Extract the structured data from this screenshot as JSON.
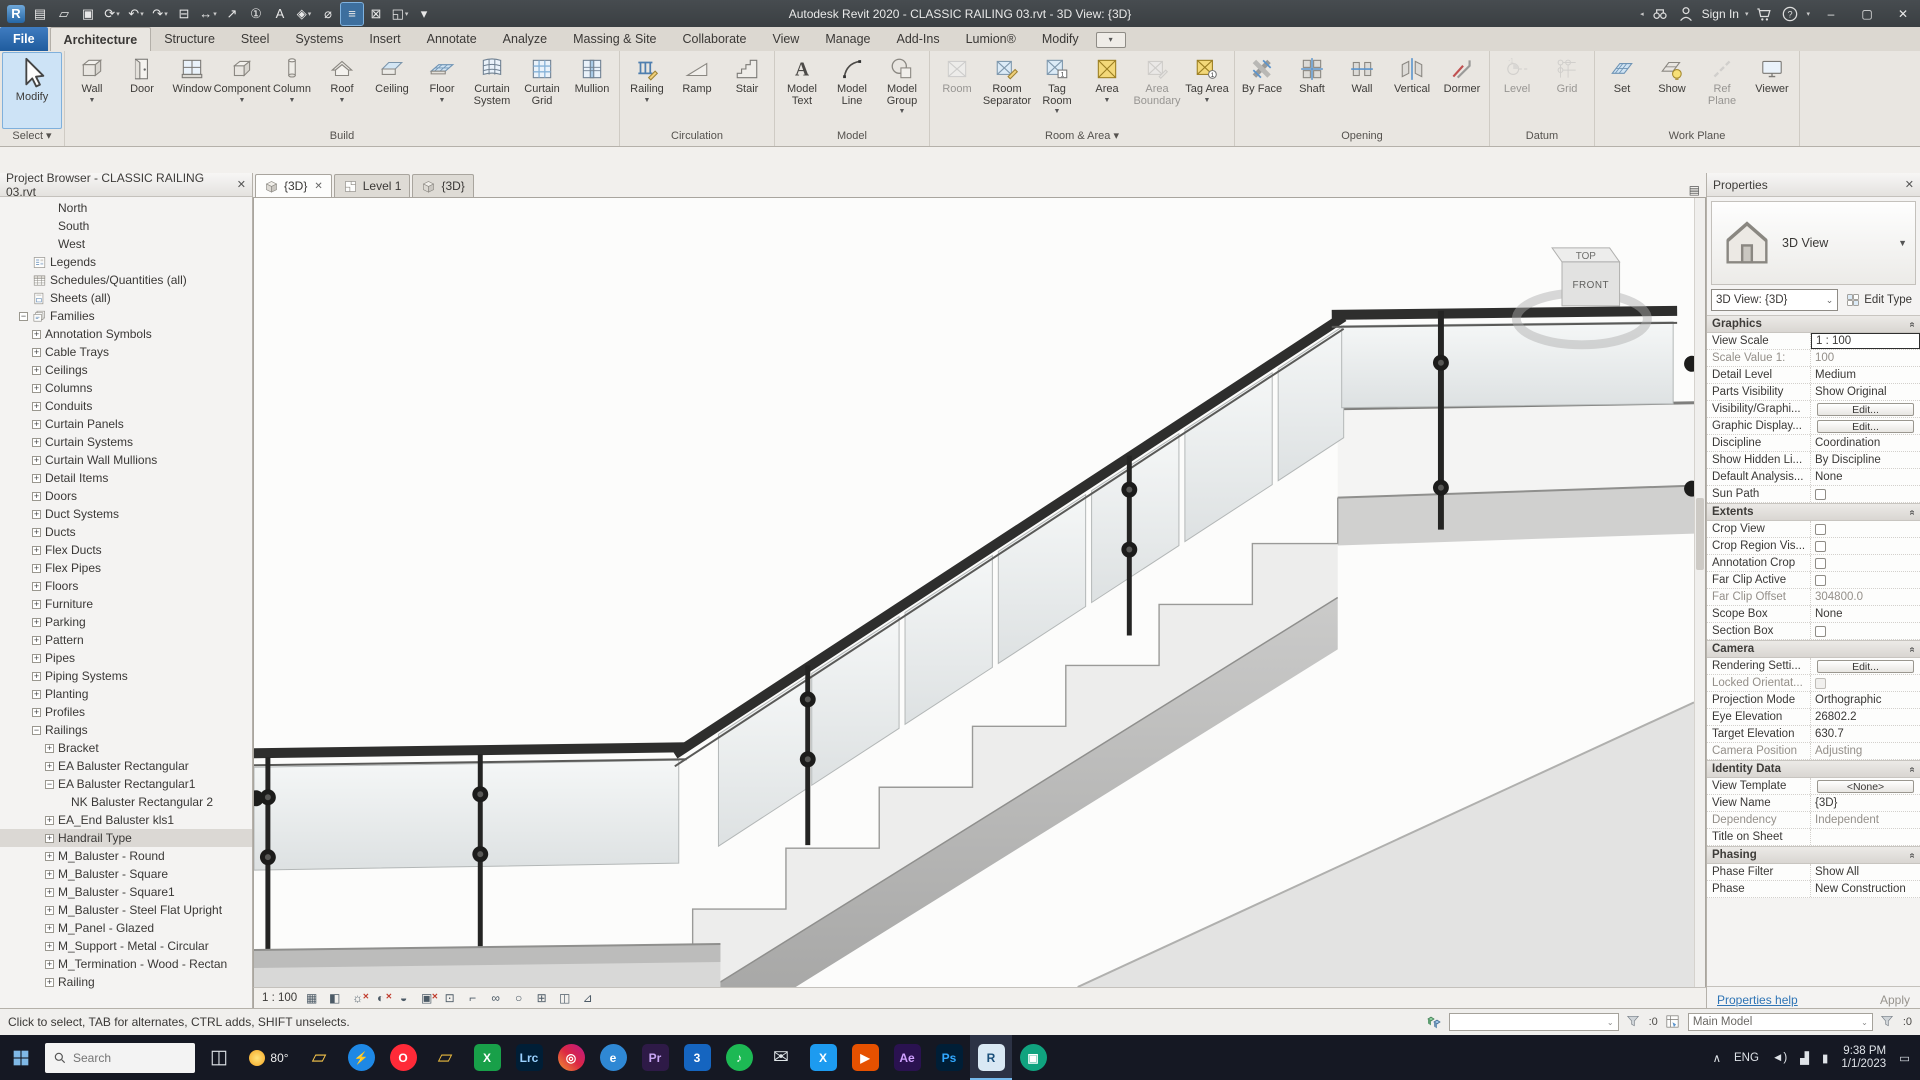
{
  "title_bar": {
    "app_title": "Autodesk Revit 2020 - CLASSIC RAILING 03.rvt - 3D View: {3D}",
    "sign_in_label": "Sign In",
    "qat": [
      {
        "name": "revit-logo-icon",
        "logo": true
      },
      {
        "name": "properties-icon",
        "glyph": "▤"
      },
      {
        "name": "open-icon",
        "glyph": "▱"
      },
      {
        "name": "save-icon",
        "glyph": "▣"
      },
      {
        "name": "sync-with-central-icon",
        "glyph": "⟳",
        "dd": true
      },
      {
        "name": "undo-icon",
        "glyph": "↶",
        "dd": true
      },
      {
        "name": "redo-icon",
        "glyph": "↷",
        "dd": true
      },
      {
        "name": "print-icon",
        "glyph": "⊟"
      },
      {
        "name": "measure-icon",
        "glyph": "↔",
        "dd": true
      },
      {
        "name": "aligned-dimension-icon",
        "glyph": "↗"
      },
      {
        "name": "tag-by-category-icon",
        "glyph": "①"
      },
      {
        "name": "text-icon",
        "glyph": "A"
      },
      {
        "name": "default-3d-view-icon",
        "glyph": "◈",
        "dd": true
      },
      {
        "name": "section-icon",
        "glyph": "⌀"
      },
      {
        "name": "thin-lines-icon",
        "glyph": "≡",
        "hl": true
      },
      {
        "name": "close-inactive-windows-icon",
        "glyph": "⊠"
      },
      {
        "name": "switch-windows-icon",
        "glyph": "◱",
        "dd": true
      },
      {
        "name": "customize-qat-icon",
        "glyph": "▾"
      }
    ]
  },
  "ribbon": {
    "tabs": [
      {
        "label": "File",
        "file": true
      },
      {
        "label": "Architecture",
        "active": true
      },
      {
        "label": "Structure"
      },
      {
        "label": "Steel"
      },
      {
        "label": "Systems"
      },
      {
        "label": "Insert"
      },
      {
        "label": "Annotate"
      },
      {
        "label": "Analyze"
      },
      {
        "label": "Massing & Site"
      },
      {
        "label": "Collaborate"
      },
      {
        "label": "View"
      },
      {
        "label": "Manage"
      },
      {
        "label": "Add-Ins"
      },
      {
        "label": "Lumion®"
      },
      {
        "label": "Modify"
      }
    ],
    "panels": [
      {
        "name": "Select",
        "dd": true,
        "buttons": [
          {
            "label": "Modify",
            "icon": "cursor",
            "selected": true,
            "big": true
          }
        ]
      },
      {
        "name": "Build",
        "buttons": [
          {
            "label": "Wall",
            "icon": "box3d",
            "dd": true
          },
          {
            "label": "Door",
            "icon": "door"
          },
          {
            "label": "Window",
            "icon": "window"
          },
          {
            "label": "Component",
            "icon": "component",
            "dd": true
          },
          {
            "label": "Column",
            "icon": "column",
            "dd": true
          },
          {
            "label": "Roof",
            "icon": "roof",
            "dd": true
          },
          {
            "label": "Ceiling",
            "icon": "ceiling"
          },
          {
            "label": "Floor",
            "icon": "floor",
            "dd": true
          },
          {
            "label": "Curtain System",
            "icon": "curtain-system"
          },
          {
            "label": "Curtain Grid",
            "icon": "curtain-grid"
          },
          {
            "label": "Mullion",
            "icon": "mullion"
          }
        ]
      },
      {
        "name": "Circulation",
        "buttons": [
          {
            "label": "Railing",
            "icon": "railing",
            "dd": true
          },
          {
            "label": "Ramp",
            "icon": "ramp"
          },
          {
            "label": "Stair",
            "icon": "stair"
          }
        ]
      },
      {
        "name": "Model",
        "buttons": [
          {
            "label": "Model Text",
            "icon": "model-text"
          },
          {
            "label": "Model Line",
            "icon": "model-line"
          },
          {
            "label": "Model Group",
            "icon": "model-group",
            "dd": true
          }
        ]
      },
      {
        "name": "Room & Area",
        "dd": true,
        "buttons": [
          {
            "label": "Room",
            "icon": "room",
            "disabled": true
          },
          {
            "label": "Room Separator",
            "icon": "room-separator"
          },
          {
            "label": "Tag Room",
            "icon": "tag-room",
            "dd": true
          },
          {
            "label": "Area",
            "icon": "area",
            "dd": true
          },
          {
            "label": "Area Boundary",
            "icon": "area-boundary",
            "disabled": true
          },
          {
            "label": "Tag Area",
            "icon": "tag-area",
            "dd": true
          }
        ]
      },
      {
        "name": "Opening",
        "buttons": [
          {
            "label": "By Face",
            "icon": "by-face"
          },
          {
            "label": "Shaft",
            "icon": "shaft"
          },
          {
            "label": "Wall",
            "name": "wall-opening-button",
            "icon": "wall-opening"
          },
          {
            "label": "Vertical",
            "icon": "vertical-opening"
          },
          {
            "label": "Dormer",
            "icon": "dormer"
          }
        ]
      },
      {
        "name": "Datum",
        "buttons": [
          {
            "label": "Level",
            "icon": "level",
            "disabled": true
          },
          {
            "label": "Grid",
            "icon": "grid",
            "disabled": true
          }
        ]
      },
      {
        "name": "Work Plane",
        "buttons": [
          {
            "label": "Set",
            "icon": "set"
          },
          {
            "label": "Show",
            "icon": "show"
          },
          {
            "label": "Ref Plane",
            "icon": "ref-plane",
            "disabled": true
          },
          {
            "label": "Viewer",
            "icon": "viewer"
          }
        ]
      }
    ]
  },
  "project_browser": {
    "title": "Project Browser - CLASSIC RAILING 03.rvt",
    "items": [
      {
        "label": "North",
        "depth": 3
      },
      {
        "label": "South",
        "depth": 3
      },
      {
        "label": "West",
        "depth": 3
      },
      {
        "label": "Legends",
        "depth": 1,
        "icon": "legend"
      },
      {
        "label": "Schedules/Quantities (all)",
        "depth": 1,
        "icon": "schedule"
      },
      {
        "label": "Sheets (all)",
        "depth": 1,
        "icon": "sheet"
      },
      {
        "label": "Families",
        "depth": 1,
        "exp": "minus",
        "icon": "family"
      },
      {
        "label": "Annotation Symbols",
        "depth": 2,
        "exp": "plus"
      },
      {
        "label": "Cable Trays",
        "depth": 2,
        "exp": "plus"
      },
      {
        "label": "Ceilings",
        "depth": 2,
        "exp": "plus"
      },
      {
        "label": "Columns",
        "depth": 2,
        "exp": "plus"
      },
      {
        "label": "Conduits",
        "depth": 2,
        "exp": "plus"
      },
      {
        "label": "Curtain Panels",
        "depth": 2,
        "exp": "plus"
      },
      {
        "label": "Curtain Systems",
        "depth": 2,
        "exp": "plus"
      },
      {
        "label": "Curtain Wall Mullions",
        "depth": 2,
        "exp": "plus"
      },
      {
        "label": "Detail Items",
        "depth": 2,
        "exp": "plus"
      },
      {
        "label": "Doors",
        "depth": 2,
        "exp": "plus"
      },
      {
        "label": "Duct Systems",
        "depth": 2,
        "exp": "plus"
      },
      {
        "label": "Ducts",
        "depth": 2,
        "exp": "plus"
      },
      {
        "label": "Flex Ducts",
        "depth": 2,
        "exp": "plus"
      },
      {
        "label": "Flex Pipes",
        "depth": 2,
        "exp": "plus"
      },
      {
        "label": "Floors",
        "depth": 2,
        "exp": "plus"
      },
      {
        "label": "Furniture",
        "depth": 2,
        "exp": "plus"
      },
      {
        "label": "Parking",
        "depth": 2,
        "exp": "plus"
      },
      {
        "label": "Pattern",
        "depth": 2,
        "exp": "plus"
      },
      {
        "label": "Pipes",
        "depth": 2,
        "exp": "plus"
      },
      {
        "label": "Piping Systems",
        "depth": 2,
        "exp": "plus"
      },
      {
        "label": "Planting",
        "depth": 2,
        "exp": "plus"
      },
      {
        "label": "Profiles",
        "depth": 2,
        "exp": "plus"
      },
      {
        "label": "Railings",
        "depth": 2,
        "exp": "minus"
      },
      {
        "label": "Bracket",
        "depth": 3,
        "exp": "plus"
      },
      {
        "label": "EA Baluster Rectangular",
        "depth": 3,
        "exp": "plus"
      },
      {
        "label": "EA Baluster Rectangular1",
        "depth": 3,
        "exp": "minus"
      },
      {
        "label": "NK Baluster Rectangular 2",
        "depth": 4
      },
      {
        "label": "EA_End Baluster kls1",
        "depth": 3,
        "exp": "plus"
      },
      {
        "label": "Handrail Type",
        "depth": 3,
        "exp": "plus",
        "selected": true
      },
      {
        "label": "M_Baluster - Round",
        "depth": 3,
        "exp": "plus"
      },
      {
        "label": "M_Baluster - Square",
        "depth": 3,
        "exp": "plus"
      },
      {
        "label": "M_Baluster - Square1",
        "depth": 3,
        "exp": "plus"
      },
      {
        "label": "M_Baluster - Steel Flat Upright",
        "depth": 3,
        "exp": "plus"
      },
      {
        "label": "M_Panel - Glazed",
        "depth": 3,
        "exp": "plus"
      },
      {
        "label": "M_Support - Metal - Circular",
        "depth": 3,
        "exp": "plus"
      },
      {
        "label": "M_Termination - Wood - Rectan",
        "depth": 3,
        "exp": "plus"
      },
      {
        "label": "Railing",
        "depth": 3,
        "exp": "plus"
      }
    ]
  },
  "view_tabs": [
    {
      "label": "{3D}",
      "icon": "cube",
      "active": true,
      "closable": true
    },
    {
      "label": "Level 1",
      "icon": "plan"
    },
    {
      "label": "{3D}",
      "icon": "cube"
    }
  ],
  "canvas": {
    "viewcube_top": "TOP",
    "viewcube_front": "FRONT"
  },
  "view_control_bar": {
    "scale_label": "1 : 100",
    "icons": [
      {
        "name": "detail-level-icon",
        "glyph": "▦"
      },
      {
        "name": "visual-style-icon",
        "glyph": "◧"
      },
      {
        "name": "sun-path-icon",
        "glyph": "☼",
        "x": true
      },
      {
        "name": "shadows-icon",
        "glyph": "◐",
        "x": true
      },
      {
        "name": "rendering-dialog-icon",
        "glyph": "◒"
      },
      {
        "name": "crop-view-icon",
        "glyph": "▣",
        "x": true
      },
      {
        "name": "crop-region-icon",
        "glyph": "⊡"
      },
      {
        "name": "unlocked-3d-view-icon",
        "glyph": "⌐"
      },
      {
        "name": "reveal-hidden-elements-icon",
        "glyph": "∞"
      },
      {
        "name": "temporary-view-properties-icon",
        "glyph": "○"
      },
      {
        "name": "worksharing-display-icon",
        "glyph": "⊞"
      },
      {
        "name": "displacement-icon",
        "glyph": "◫"
      },
      {
        "name": "constraints-icon",
        "glyph": "⊿"
      }
    ]
  },
  "status_bar": {
    "message": "Click to select, TAB for alternates, CTRL adds, SHIFT unselects.",
    "worksets_value": "",
    "worksets_badge": ":0",
    "design_option_value": "Main Model",
    "filter_badge": ":0"
  },
  "properties": {
    "title": "Properties",
    "preview_label": "3D View",
    "type_selector": "3D View: {3D}",
    "edit_type_label": "Edit Type",
    "sections": [
      {
        "name": "Graphics",
        "rows": [
          {
            "label": "View Scale",
            "value": "1 : 100",
            "kind": "input-active"
          },
          {
            "label": "Scale Value    1:",
            "value": "100",
            "kind": "disabled"
          },
          {
            "label": "Detail Level",
            "value": "Medium"
          },
          {
            "label": "Parts Visibility",
            "value": "Show Original"
          },
          {
            "label": "Visibility/Graphi...",
            "value": "Edit...",
            "kind": "button"
          },
          {
            "label": "Graphic Display...",
            "value": "Edit...",
            "kind": "button"
          },
          {
            "label": "Discipline",
            "value": "Coordination"
          },
          {
            "label": "Show Hidden Li...",
            "value": "By Discipline"
          },
          {
            "label": "Default Analysis...",
            "value": "None"
          },
          {
            "label": "Sun Path",
            "kind": "checkbox"
          }
        ]
      },
      {
        "name": "Extents",
        "rows": [
          {
            "label": "Crop View",
            "kind": "checkbox"
          },
          {
            "label": "Crop Region Vis...",
            "kind": "checkbox"
          },
          {
            "label": "Annotation Crop",
            "kind": "checkbox"
          },
          {
            "label": "Far Clip Active",
            "kind": "checkbox"
          },
          {
            "label": "Far Clip Offset",
            "value": "304800.0",
            "kind": "disabled"
          },
          {
            "label": "Scope Box",
            "value": "None"
          },
          {
            "label": "Section Box",
            "kind": "checkbox"
          }
        ]
      },
      {
        "name": "Camera",
        "rows": [
          {
            "label": "Rendering Setti...",
            "value": "Edit...",
            "kind": "button"
          },
          {
            "label": "Locked Orientat...",
            "kind": "checkbox-disabled"
          },
          {
            "label": "Projection Mode",
            "value": "Orthographic"
          },
          {
            "label": "Eye Elevation",
            "value": "26802.2"
          },
          {
            "label": "Target Elevation",
            "value": "630.7"
          },
          {
            "label": "Camera Position",
            "value": "Adjusting",
            "kind": "disabled"
          }
        ]
      },
      {
        "name": "Identity Data",
        "rows": [
          {
            "label": "View Template",
            "value": "<None>",
            "kind": "button"
          },
          {
            "label": "View Name",
            "value": "{3D}"
          },
          {
            "label": "Dependency",
            "value": "Independent",
            "kind": "disabled"
          },
          {
            "label": "Title on Sheet",
            "value": ""
          }
        ]
      },
      {
        "name": "Phasing",
        "rows": [
          {
            "label": "Phase Filter",
            "value": "Show All"
          },
          {
            "label": "Phase",
            "value": "New Construction"
          }
        ]
      }
    ],
    "help_link": "Properties help",
    "apply_label": "Apply"
  },
  "taskbar": {
    "search_placeholder": "Search",
    "weather_label": "80°",
    "apps": [
      {
        "name": "task-view",
        "kind": "glyph",
        "glyph": "◫",
        "fg": "#dfe3e8"
      },
      {
        "name": "weather",
        "kind": "weather"
      },
      {
        "name": "file-explorer",
        "kind": "glyph",
        "glyph": "▱",
        "fg": "#f7c64b"
      },
      {
        "name": "messenger",
        "kind": "app",
        "shape": "circle",
        "bg": "#1e88e5",
        "text": "⚡"
      },
      {
        "name": "opera",
        "kind": "app",
        "shape": "circle",
        "bg": "#ff2a38",
        "text": "O"
      },
      {
        "name": "folder",
        "kind": "glyph",
        "glyph": "▱",
        "fg": "#e8b93e"
      },
      {
        "name": "calc",
        "kind": "app",
        "bg": "#18a049",
        "text": "X"
      },
      {
        "name": "lightroom",
        "kind": "app",
        "bg": "#001e36",
        "fg": "#9ad1ff",
        "text": "Lrc"
      },
      {
        "name": "instagram",
        "kind": "app",
        "shape": "circle",
        "bg": "linear-gradient(45deg,#f09433,#dc2743,#bc1888)",
        "text": "◎"
      },
      {
        "name": "edge",
        "kind": "app",
        "shape": "circle",
        "bg": "#2f88d4",
        "text": "e"
      },
      {
        "name": "premiere",
        "kind": "app",
        "bg": "#2e1a47",
        "fg": "#c9a6f5",
        "text": "Pr"
      },
      {
        "name": "app-3",
        "kind": "app",
        "bg": "#1565c0",
        "text": "3"
      },
      {
        "name": "spotify",
        "kind": "app",
        "shape": "circle",
        "bg": "#1db954",
        "text": "♪"
      },
      {
        "name": "mail",
        "kind": "glyph",
        "glyph": "✉",
        "fg": "#dfe5e8"
      },
      {
        "name": "x-app",
        "kind": "app",
        "bg": "#1d9bf0",
        "text": "X"
      },
      {
        "name": "media-player",
        "kind": "app",
        "bg": "#e65100",
        "text": "▶"
      },
      {
        "name": "after-effects",
        "kind": "app",
        "bg": "#2a1250",
        "fg": "#cfa0ff",
        "text": "Ae"
      },
      {
        "name": "photoshop",
        "kind": "app",
        "bg": "#001e36",
        "fg": "#31a8ff",
        "text": "Ps"
      },
      {
        "name": "revit",
        "kind": "app",
        "bg": "#d9e8f4",
        "fg": "#1a4f7a",
        "text": "R",
        "active": true
      },
      {
        "name": "screen-share",
        "kind": "app",
        "shape": "circle",
        "bg": "#10a37f",
        "text": "▣"
      }
    ],
    "tray": [
      {
        "name": "hidden-icons-icon",
        "glyph": "∧"
      },
      {
        "name": "language-indicator",
        "text": "ENG"
      },
      {
        "name": "volume-icon",
        "glyph": "◄)"
      },
      {
        "name": "network-icon",
        "glyph": "▟"
      },
      {
        "name": "battery-icon",
        "glyph": "▮"
      }
    ],
    "time": "9:38 PM",
    "date": "1/1/2023",
    "notification_glyph": "▭"
  }
}
